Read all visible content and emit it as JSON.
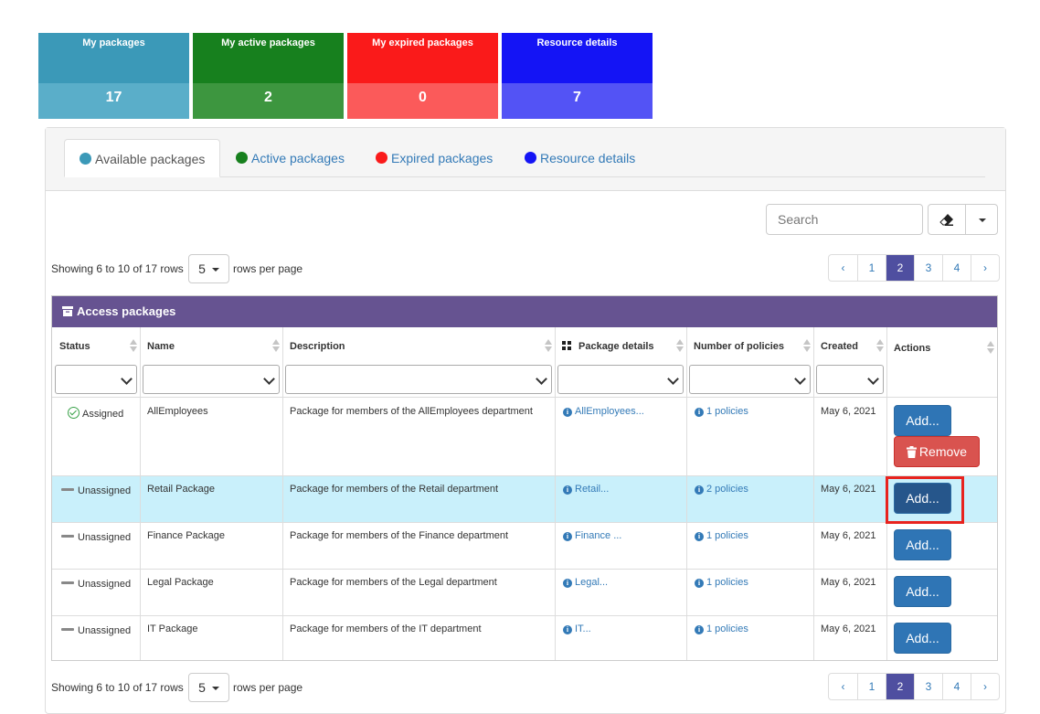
{
  "tiles": [
    {
      "label": "My packages",
      "value": "17",
      "top_color": "#3b99b8",
      "bottom_color": "#5aaec9"
    },
    {
      "label": "My active packages",
      "value": "2",
      "top_color": "#17801e",
      "bottom_color": "#3d963f"
    },
    {
      "label": "My expired packages",
      "value": "0",
      "top_color": "#fa1a1a",
      "bottom_color": "#fb5a5a"
    },
    {
      "label": "Resource details",
      "value": "7",
      "top_color": "#1414f5",
      "bottom_color": "#5353f5"
    }
  ],
  "tabs": [
    {
      "label": "Available packages",
      "color": "#3b99b8"
    },
    {
      "label": "Active packages",
      "color": "#17801e"
    },
    {
      "label": "Expired packages",
      "color": "#fa1a1a"
    },
    {
      "label": "Resource details",
      "color": "#1414f5"
    }
  ],
  "search": {
    "placeholder": "Search"
  },
  "pagination": {
    "info": "Showing 6 to 10 of 17 rows",
    "page_size": "5",
    "rows_per_page": "rows per page",
    "prev": "‹",
    "next": "›",
    "pages": [
      "1",
      "2",
      "3",
      "4"
    ],
    "current": "2"
  },
  "table": {
    "title": "Access packages",
    "columns": [
      "Status",
      "Name",
      "Description",
      "Package details",
      "Number of policies",
      "Created",
      "Actions"
    ],
    "rows": [
      {
        "status": "Assigned",
        "name": "AllEmployees",
        "description": "Package for members of the AllEmployees department",
        "details": "AllEmployees...",
        "policies": "1 policies",
        "created": "May 6, 2021",
        "add": "Add...",
        "remove": "Remove"
      },
      {
        "status": "Unassigned",
        "name": "Retail Package",
        "description": "Package for members of the Retail department",
        "details": "Retail...",
        "policies": "2 policies",
        "created": "May 6, 2021",
        "add": "Add..."
      },
      {
        "status": "Unassigned",
        "name": "Finance Package",
        "description": "Package for members of the Finance department",
        "details": "Finance ...",
        "policies": "1 policies",
        "created": "May 6, 2021",
        "add": "Add..."
      },
      {
        "status": "Unassigned",
        "name": "Legal Package",
        "description": "Package for members of the Legal department",
        "details": "Legal...",
        "policies": "1 policies",
        "created": "May 6, 2021",
        "add": "Add..."
      },
      {
        "status": "Unassigned",
        "name": "IT Package",
        "description": "Package for members of the IT department",
        "details": "IT...",
        "policies": "1 policies",
        "created": "May 6, 2021",
        "add": "Add..."
      }
    ]
  }
}
